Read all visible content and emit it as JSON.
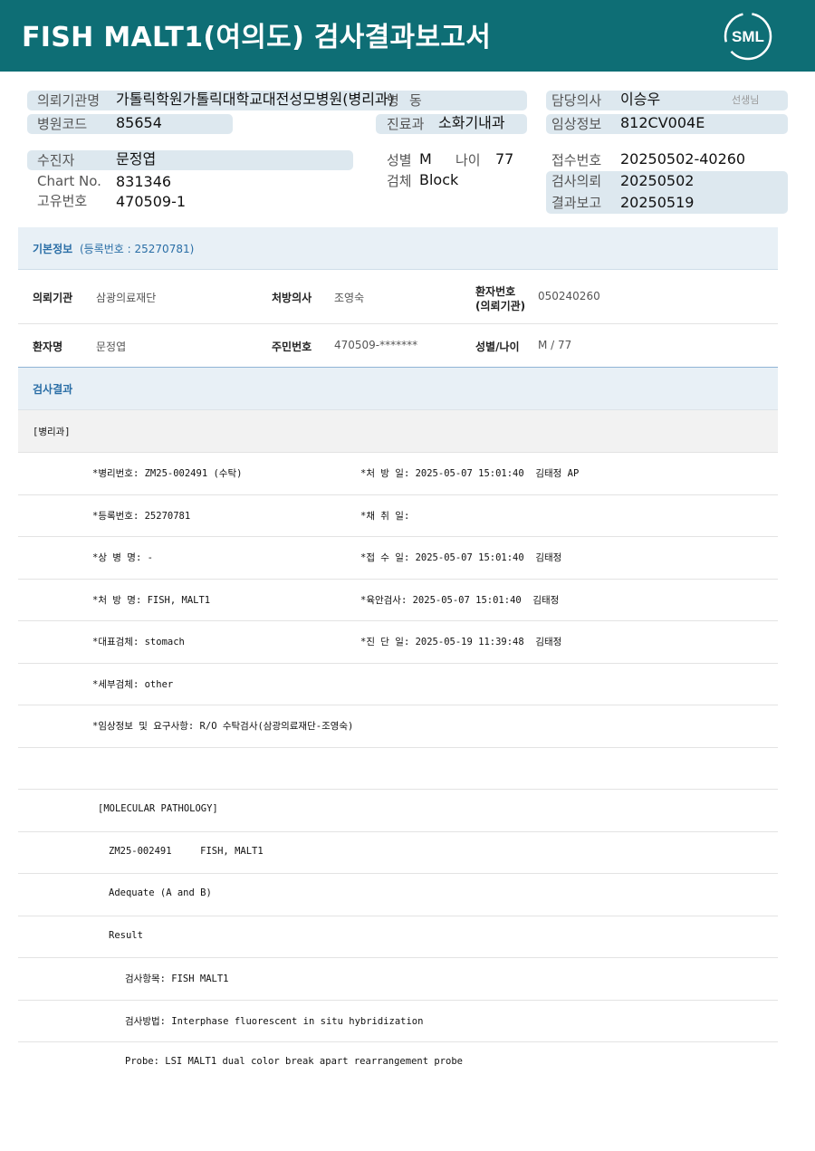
{
  "header": {
    "title": "FISH MALT1(여의도) 검사결과보고서",
    "logo_text": "SML"
  },
  "info": {
    "hospital_label": "의뢰기관명",
    "hospital_value": "가톨릭학원가톨릭대학교대전성모병원(병리과)",
    "ward_label": "병",
    "ward_value": "동",
    "doctor_label": "담당의사",
    "doctor_value": "이승우",
    "doctor_suffix": "선생님",
    "code_label": "병원코드",
    "code_value": "85654",
    "dept_label": "진료과",
    "dept_value": "소화기내과",
    "clinical_label": "임상정보",
    "clinical_value": "812CV004E",
    "patient_label": "수진자",
    "patient_value": "문정엽",
    "sex_label": "성별",
    "sex_value": "M",
    "age_label": "나이",
    "age_value": "77",
    "receipt_label": "접수번호",
    "receipt_value": "20250502-40260",
    "chart_label": "Chart No.",
    "chart_value": "831346",
    "specimen_label": "검체",
    "specimen_value": "Block",
    "request_label": "검사의뢰",
    "request_value": "20250502",
    "uid_label": "고유번호",
    "uid_value": "470509-1",
    "report_label": "결과보고",
    "report_value": "20250519"
  },
  "basic": {
    "title": "기본정보",
    "subtitle": "(등록번호 : 25270781)",
    "institution_label": "의뢰기관",
    "institution_value": "삼광의료재단",
    "prescriber_label": "처방의사",
    "prescriber_value": "조영숙",
    "patno_label_1": "환자번호",
    "patno_label_2": "(의뢰기관)",
    "patno_value": "050240260",
    "name_label": "환자명",
    "name_value": "문정엽",
    "rrn_label": "주민번호",
    "rrn_value": "470509-*******",
    "sexage_label": "성별/나이",
    "sexage_value": "M / 77"
  },
  "result": {
    "title": "검사결과",
    "dept": "[병리과]",
    "lines": [
      {
        "left": "*병리번호: ZM25-002491 (수탁)",
        "right": "*처 방 일: 2025-05-07 15:01:40  김태정 AP"
      },
      {
        "left": "*등록번호: 25270781",
        "right": "*채 취 일:"
      },
      {
        "left": "*상 병 명: -",
        "right": "*접 수 일: 2025-05-07 15:01:40  김태정"
      },
      {
        "left": "*처 방 명: FISH, MALT1",
        "right": "*육안검사: 2025-05-07 15:01:40  김태정"
      },
      {
        "left": "*대표검체: stomach",
        "right": "*진 단 일: 2025-05-19 11:39:48  김태정"
      },
      {
        "left": "*세부검체: other",
        "right": ""
      },
      {
        "left": "*임상정보 및 요구사항: R/O 수탁검사(삼광의료재단-조영숙)",
        "right": ""
      }
    ],
    "molecular": [
      "[MOLECULAR PATHOLOGY]",
      "ZM25-002491     FISH, MALT1",
      "Adequate (A and B)",
      "Result",
      "검사항목: FISH MALT1",
      "검사방법: Interphase fluorescent in situ hybridization",
      "Probe: LSI MALT1 dual color break apart rearrangement probe"
    ]
  }
}
